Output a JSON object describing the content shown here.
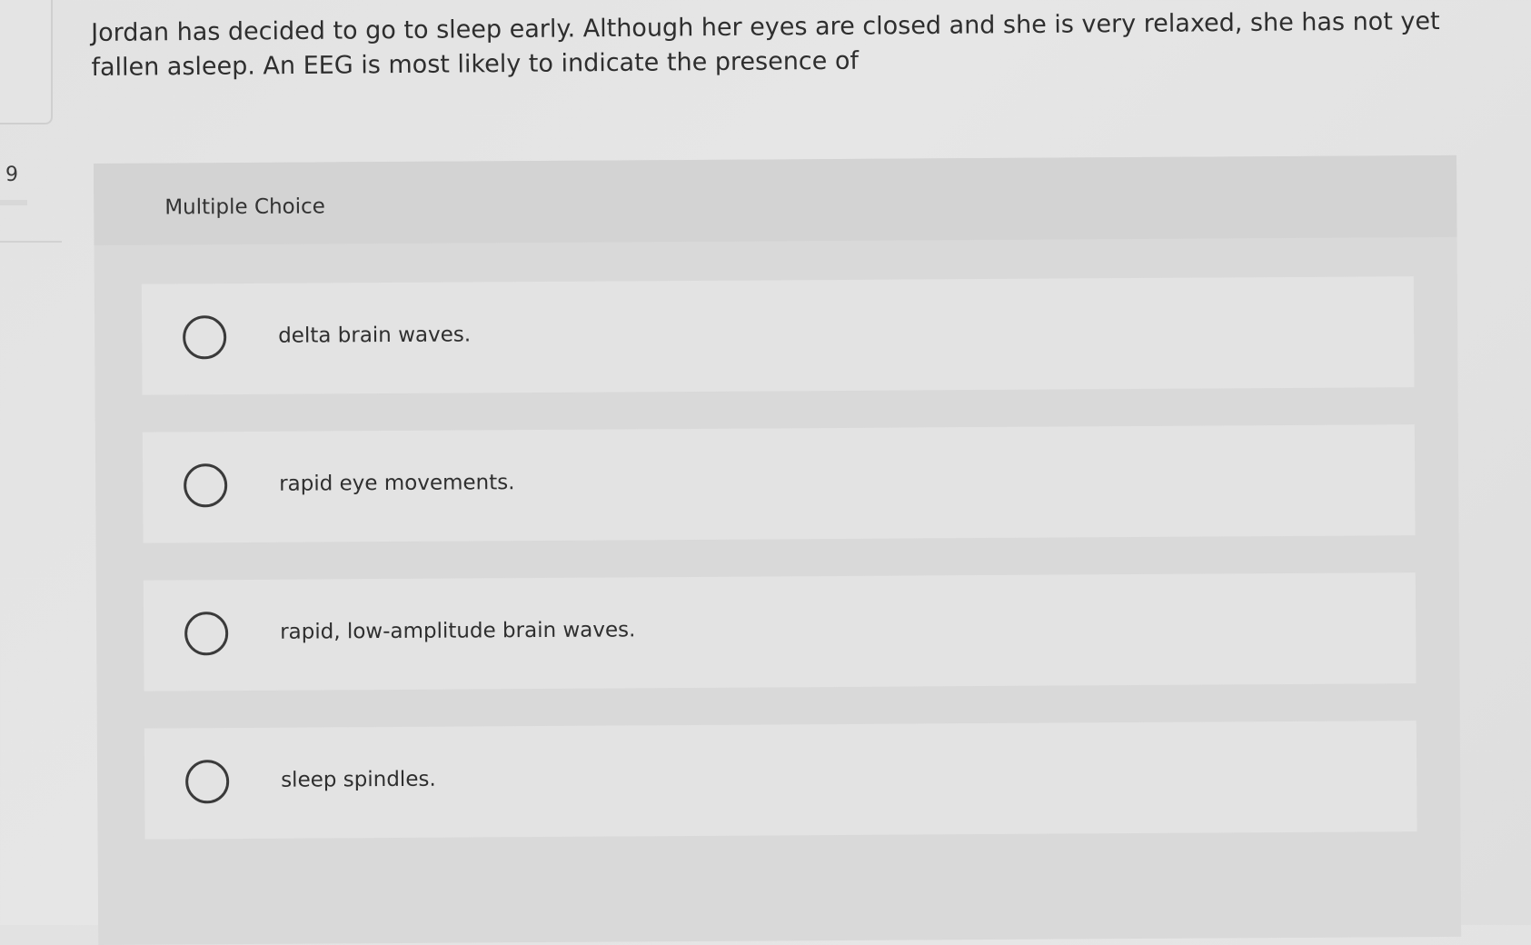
{
  "question": {
    "number": "9",
    "prompt": "Jordan has decided to go to sleep early. Although her eyes are closed and she is very relaxed, she has not yet fallen asleep. An EEG is most likely to indicate the presence of"
  },
  "choices": {
    "label": "Multiple Choice",
    "options": [
      {
        "text": "delta brain waves."
      },
      {
        "text": "rapid eye movements."
      },
      {
        "text": "rapid, low-amplitude brain waves."
      },
      {
        "text": "sleep spindles."
      }
    ]
  }
}
